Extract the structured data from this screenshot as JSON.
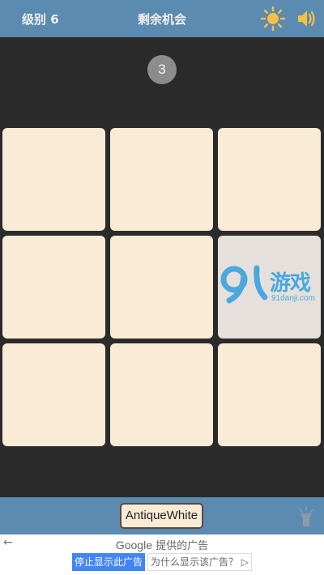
{
  "topbar": {
    "level_label": "级别 6",
    "chances_label": "剩余机会",
    "sun_icon": "sun-icon",
    "speaker_icon": "speaker-icon"
  },
  "game": {
    "counter": "3",
    "tile_color": "#faebd7",
    "odd_tile_color": "#e6e0dc"
  },
  "watermark": {
    "brand": "游戏",
    "domain": "91danji.com"
  },
  "bottombar": {
    "color_name": "AntiqueWhite",
    "hint_icon": "flashlight-icon"
  },
  "ad": {
    "title_brand": "Google",
    "title_suffix": " 提供的广告",
    "stop_label": "停止显示此广告",
    "why_label": "为什么显示该广告？ ▷",
    "back": "←"
  }
}
